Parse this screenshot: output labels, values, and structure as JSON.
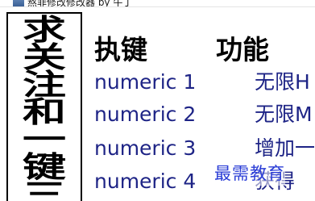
{
  "window": {
    "title": "熬菲修改修改器 by 牛丁"
  },
  "side_panel": {
    "chars": [
      "求",
      "关",
      "注",
      "和",
      "一",
      "键",
      "三"
    ]
  },
  "table": {
    "headers": [
      "执键",
      "功能"
    ],
    "rows": [
      {
        "key": "numeric 1",
        "function": "无限H"
      },
      {
        "key": "numeric 2",
        "function": "无限M"
      },
      {
        "key": "numeric 3",
        "function": "增加一"
      },
      {
        "key": "numeric 4",
        "function": "获得"
      }
    ]
  },
  "watermark": {
    "text": "最需教育"
  },
  "colors": {
    "row_text": "#1e2486",
    "watermark": "#2a3dd6"
  }
}
